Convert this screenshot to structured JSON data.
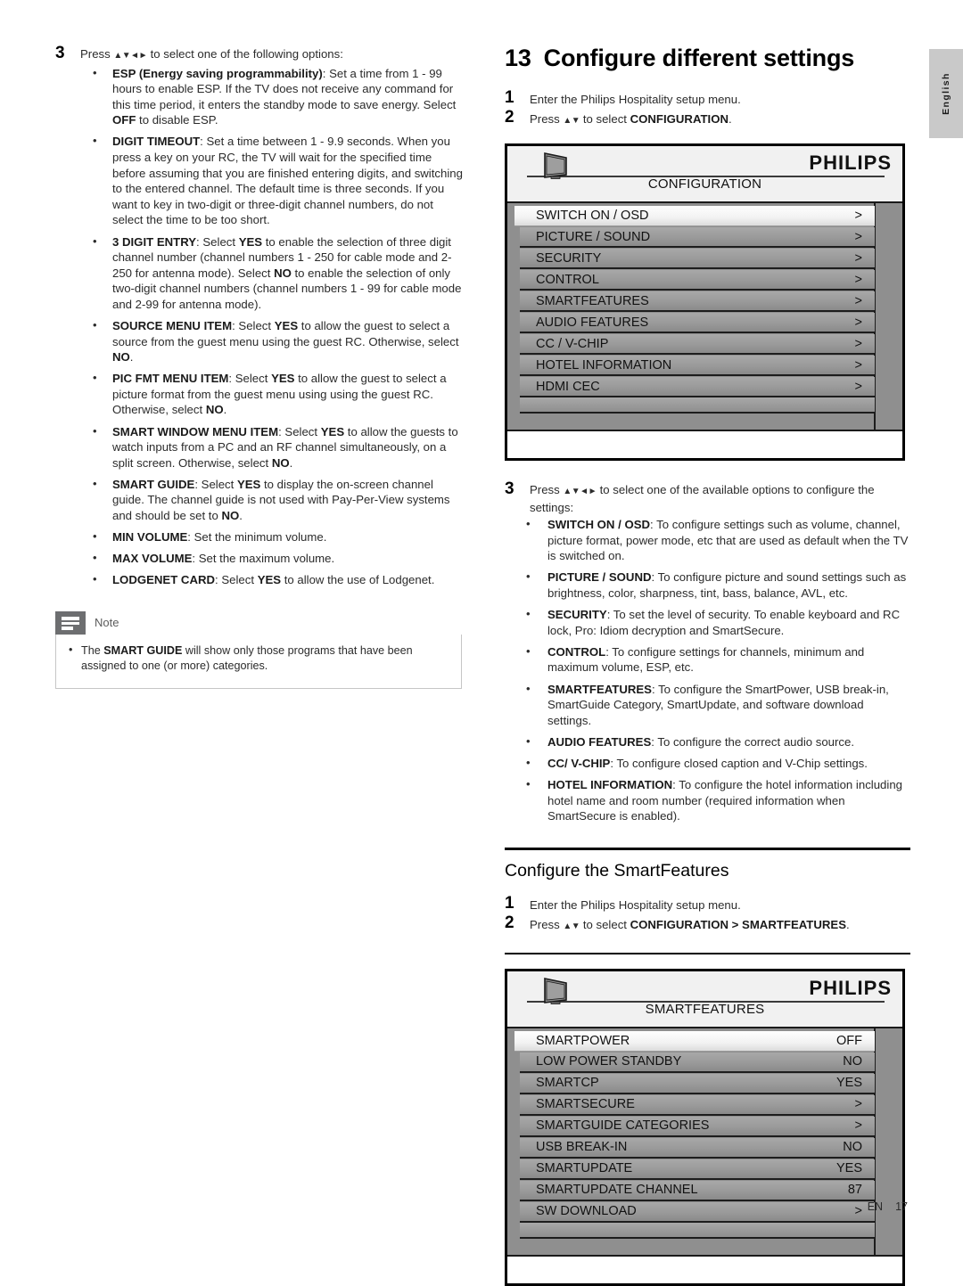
{
  "page": {
    "language_tab": "English",
    "footer_lang": "EN",
    "footer_page": "17"
  },
  "left_column": {
    "step": {
      "number": "3",
      "text_before": "Press ",
      "arrows": "▲▼◄►",
      "text_after": " to select one of the following options:"
    },
    "bullets": [
      {
        "term": "ESP (Energy saving programmability)",
        "term_suffix": ":",
        "desc": " Set a time from 1 - 99 hours to enable ESP. If the TV does not receive any command for this time period, it enters the standby mode to save energy. Select ",
        "emph1": "OFF",
        "desc2": " to disable ESP."
      },
      {
        "term": "DIGIT TIMEOUT",
        "term_suffix": ":",
        "desc": " Set a time between 1 - 9.9 seconds. When you press a key on your RC, the TV will wait for the specified time before assuming that you are finished entering digits, and switching to the entered channel. The default time is three seconds. If you want to key in two-digit or three-digit channel numbers, do not select the time to be too short."
      },
      {
        "term": "3 DIGIT ENTRY",
        "term_suffix": ":",
        "desc": " Select ",
        "emph1": "YES",
        "desc2": " to enable the selection of three digit channel number (channel numbers 1 - 250 for cable mode and 2-250 for antenna mode). Select ",
        "emph2": "NO",
        "desc3": " to enable the selection of only two-digit channel numbers (channel numbers 1 - 99 for cable mode and 2-99 for antenna mode)."
      },
      {
        "term": "SOURCE MENU ITEM",
        "term_suffix": ":",
        "desc": " Select ",
        "emph1": "YES",
        "desc2": " to allow the guest to select a source from the guest menu using the guest RC. Otherwise, select ",
        "emph2": "NO",
        "desc3": "."
      },
      {
        "term": "PIC FMT MENU ITEM",
        "term_suffix": ":",
        "desc": " Select ",
        "emph1": "YES",
        "desc2": " to allow the guest to select a picture format from the guest menu using using the guest RC. Otherwise, select ",
        "emph2": "NO",
        "desc3": "."
      },
      {
        "term": "SMART WINDOW MENU ITEM",
        "term_suffix": ":",
        "desc": " Select ",
        "emph1": "YES",
        "desc2": " to allow the guests to watch inputs from a PC and an RF channel simultaneously, on a split screen. Otherwise, select ",
        "emph2": "NO",
        "desc3": "."
      },
      {
        "term": "SMART GUIDE",
        "term_suffix": ":",
        "desc": " Select ",
        "emph1": "YES",
        "desc2": " to display the on-screen channel guide. The channel guide is not used with Pay-Per-View systems and should be set to ",
        "emph2": "NO",
        "desc3": "."
      },
      {
        "term": "MIN VOLUME",
        "term_suffix": ":",
        "desc": " Set the minimum volume."
      },
      {
        "term": "MAX VOLUME",
        "term_suffix": ":",
        "desc": " Set the maximum volume."
      },
      {
        "term": "LODGENET CARD",
        "term_suffix": ":",
        "desc": " Select ",
        "emph1": "YES",
        "desc2": " to allow the use of Lodgenet."
      }
    ],
    "note": {
      "label": "Note",
      "icon": "note-lines-icon",
      "body_pre": "The ",
      "body_bold": "SMART GUIDE",
      "body_post": " will show only those programs that have been assigned to one (or more) categories."
    }
  },
  "right_column": {
    "chapter": {
      "number": "13",
      "title": "Configure different settings"
    },
    "steps_top": [
      {
        "number": "1",
        "text": "Enter the Philips Hospitality setup menu."
      },
      {
        "number": "2",
        "text_before": "Press ",
        "arrows": "▲▼",
        "text_mid": " to select ",
        "bold": "CONFIGURATION",
        "text_after": "."
      }
    ],
    "osd_configuration": {
      "brand": "PHILIPS",
      "icon": "tv-monitor-icon",
      "title": "CONFIGURATION",
      "rows": [
        {
          "label": "SWITCH ON / OSD",
          "value": ">",
          "selected": true
        },
        {
          "label": "PICTURE / SOUND",
          "value": ">",
          "selected": false
        },
        {
          "label": "SECURITY",
          "value": ">",
          "selected": false
        },
        {
          "label": "CONTROL",
          "value": ">",
          "selected": false
        },
        {
          "label": "SMARTFEATURES",
          "value": ">",
          "selected": false
        },
        {
          "label": "AUDIO FEATURES",
          "value": ">",
          "selected": false
        },
        {
          "label": "CC / V-CHIP",
          "value": ">",
          "selected": false
        },
        {
          "label": "HOTEL INFORMATION",
          "value": ">",
          "selected": false
        },
        {
          "label": "HDMI CEC",
          "value": ">",
          "selected": false
        }
      ]
    },
    "step3": {
      "number": "3",
      "text_before": "Press ",
      "arrows": "▲▼◄►",
      "text_after": " to select one of the available options to configure the settings:"
    },
    "step3_bullets": [
      {
        "term": "SWITCH ON / OSD",
        "term_suffix": ":",
        "desc": " To configure settings such as volume, channel, picture format, power mode, etc that are used as default when the TV is switched on."
      },
      {
        "term": "PICTURE / SOUND",
        "term_suffix": ":",
        "desc": " To configure picture and sound settings such as brightness, color, sharpness, tint, bass, balance, AVL, etc."
      },
      {
        "term": "SECURITY",
        "term_suffix": ":",
        "desc": " To set the level of security. To enable keyboard and RC lock, Pro: Idiom decryption and SmartSecure."
      },
      {
        "term": "CONTROL",
        "term_suffix": ":",
        "desc": " To configure settings for channels, minimum and maximum volume, ESP, etc."
      },
      {
        "term": "SMARTFEATURES",
        "term_suffix": ":",
        "desc": " To configure the SmartPower, USB break-in, SmartGuide Category, SmartUpdate, and software download settings."
      },
      {
        "term": "AUDIO FEATURES",
        "term_suffix": ":",
        "desc": " To configure the correct audio source."
      },
      {
        "term": "CC/ V-CHIP",
        "term_suffix": ":",
        "desc": " To configure closed caption and V-Chip settings."
      },
      {
        "term": "HOTEL INFORMATION",
        "term_suffix": ":",
        "desc": " To configure the hotel information including hotel name and room number (required information when SmartSecure is enabled)."
      }
    ],
    "section2": {
      "title": "Configure the SmartFeatures",
      "steps": [
        {
          "number": "1",
          "text": "Enter the Philips Hospitality setup menu."
        },
        {
          "number": "2",
          "text_before": "Press ",
          "arrows": "▲▼",
          "text_mid": " to select ",
          "bold": "CONFIGURATION > SMARTFEATURES",
          "text_after": "."
        }
      ]
    },
    "osd_smartfeatures": {
      "brand": "PHILIPS",
      "icon": "tv-monitor-icon",
      "title": "SMARTFEATURES",
      "rows": [
        {
          "label": "SMARTPOWER",
          "value": "OFF",
          "selected": true
        },
        {
          "label": "LOW POWER STANDBY",
          "value": "NO",
          "selected": false
        },
        {
          "label": "SMARTCP",
          "value": "YES",
          "selected": false
        },
        {
          "label": "SMARTSECURE",
          "value": ">",
          "selected": false
        },
        {
          "label": "SMARTGUIDE CATEGORIES",
          "value": ">",
          "selected": false
        },
        {
          "label": "USB BREAK-IN",
          "value": "NO",
          "selected": false
        },
        {
          "label": "SMARTUPDATE",
          "value": "YES",
          "selected": false
        },
        {
          "label": "SMARTUPDATE CHANNEL",
          "value": "87",
          "selected": false
        },
        {
          "label": "SW DOWNLOAD",
          "value": ">",
          "selected": false
        }
      ]
    }
  }
}
